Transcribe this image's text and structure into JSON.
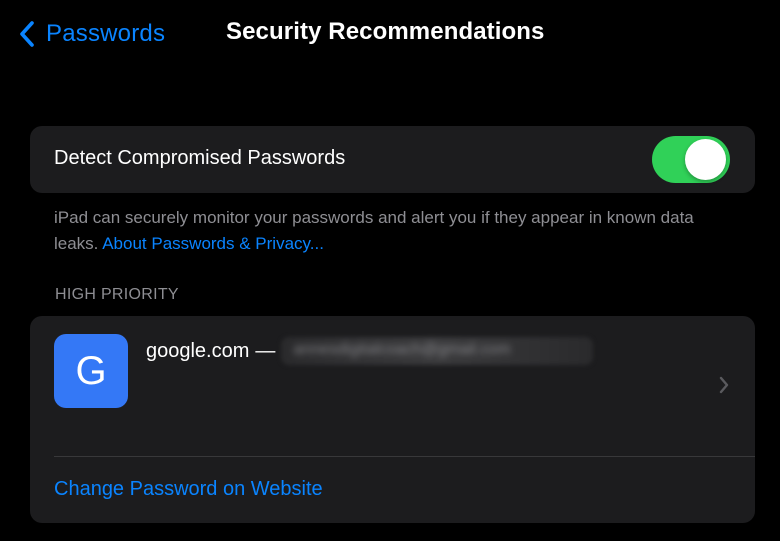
{
  "nav": {
    "back_label": "Passwords",
    "title": "Security Recommendations"
  },
  "detect": {
    "label": "Detect Compromised Passwords",
    "enabled": true,
    "toggle_color": "#30d158"
  },
  "footer": {
    "text": "iPad can securely monitor your passwords and alert you if they appear in known data leaks.",
    "link": "About Passwords & Privacy..."
  },
  "section": {
    "header": "HIGH PRIORITY"
  },
  "item": {
    "icon_letter": "G",
    "icon_color": "#3478f6",
    "site": "google.com",
    "separator": "—",
    "account_redacted": "annesdigitalcoach@gmail.com",
    "action": "Change Password on Website"
  },
  "colors": {
    "accent": "#0a84ff",
    "background": "#000000",
    "card": "#1c1c1e",
    "secondary_text": "#8e8e93"
  },
  "icons": {
    "back": "chevron-left-icon",
    "row": "chevron-right-icon"
  }
}
